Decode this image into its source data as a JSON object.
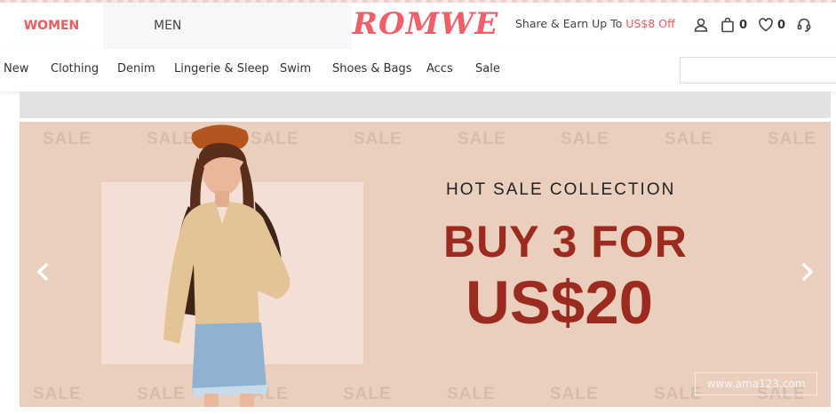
{
  "header": {
    "tabs": [
      {
        "label": "WOMEN"
      },
      {
        "label": "MEN"
      }
    ],
    "logo_text": "ROMWE",
    "promo_prefix": "Share & Earn Up To ",
    "promo_highlight": "US$8 Off",
    "bag_count": "0",
    "wishlist_count": "0"
  },
  "nav": {
    "items": [
      "New",
      "Clothing",
      "Denim",
      "Lingerie & Sleep",
      "Swim",
      "Shoes & Bags",
      "Accs",
      "Sale"
    ]
  },
  "search": {
    "placeholder": ""
  },
  "banner": {
    "bg_word": "SALE",
    "headline": "HOT SALE COLLECTION",
    "offer_line1": "BUY 3 FOR",
    "offer_line2": "US$20",
    "watermark": "www.ama123.com"
  },
  "colors": {
    "accent": "#f25b5b",
    "banner_bg": "#eacfbe",
    "offer": "#9a2b1e"
  }
}
